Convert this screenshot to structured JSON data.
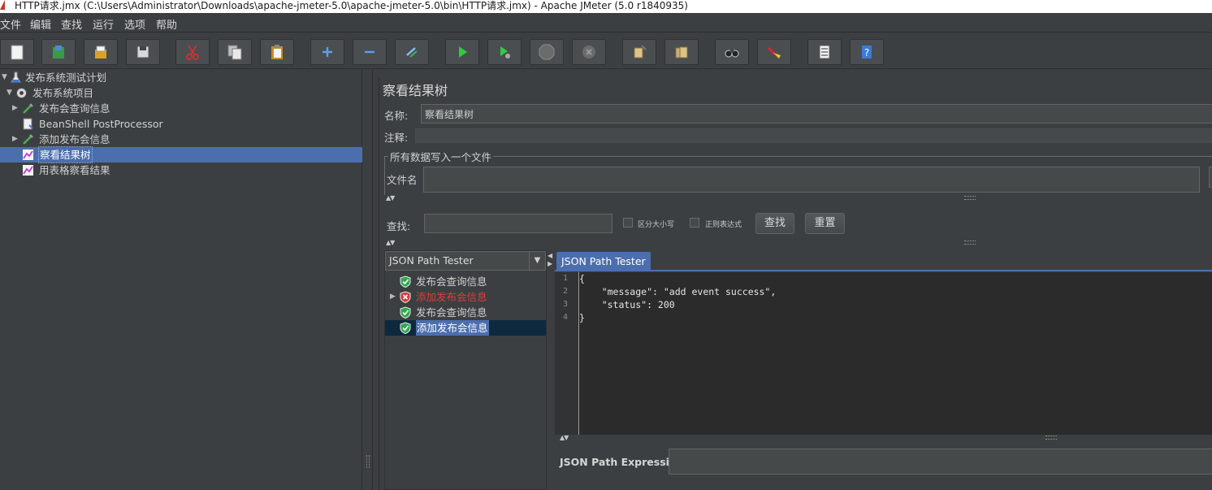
{
  "window": {
    "title": "HTTP请求.jmx (C:\\Users\\Administrator\\Downloads\\apache-jmeter-5.0\\apache-jmeter-5.0\\bin\\HTTP请求.jmx) - Apache JMeter (5.0 r1840935)"
  },
  "menu": [
    "文件",
    "编辑",
    "查找",
    "运行",
    "选项",
    "帮助"
  ],
  "toolbar": {
    "icons": [
      "new-icon",
      "templates-icon",
      "open-icon",
      "save-icon",
      "cut-icon",
      "copy-icon",
      "paste-icon",
      "expand-icon",
      "collapse-icon",
      "toggle-icon",
      "start-icon",
      "start-no-pause-icon",
      "stop-icon",
      "shutdown-icon",
      "clear-icon",
      "clear-all-icon",
      "search-icon",
      "reset-search-icon",
      "function-helper-icon",
      "help-icon"
    ]
  },
  "tree": {
    "items": [
      {
        "label": "发布系统测试计划",
        "type": "test-plan",
        "expanded": true
      },
      {
        "label": "发布系统项目",
        "type": "thread-group",
        "expanded": true
      },
      {
        "label": "发布会查询信息",
        "type": "sampler",
        "expanded": false
      },
      {
        "label": "BeanShell PostProcessor",
        "type": "post-processor"
      },
      {
        "label": "添加发布会信息",
        "type": "sampler",
        "expanded": false
      },
      {
        "label": "察看结果树",
        "type": "listener",
        "selected": true
      },
      {
        "label": "用表格察看结果",
        "type": "listener"
      }
    ]
  },
  "panel": {
    "title": "察看结果树",
    "name_label": "名称:",
    "name_value": "察看结果树",
    "comment_label": "注释:",
    "comment_value": "",
    "file_group_label": "所有数据写入一个文件",
    "filename_label": "文件名",
    "filename_value": ""
  },
  "search": {
    "label": "查找:",
    "value": "",
    "case_sensitive_label": "区分大小写",
    "case_sensitive": false,
    "regex_label": "正则表达式",
    "regex": false,
    "find_button": "查找",
    "reset_button": "重置"
  },
  "results": {
    "renderer": "JSON Path Tester",
    "items": [
      {
        "label": "发布会查询信息",
        "status": "success"
      },
      {
        "label": "添加发布会信息",
        "status": "error"
      },
      {
        "label": "发布会查询信息",
        "status": "success"
      },
      {
        "label": "添加发布会信息",
        "status": "success",
        "selected": true
      }
    ]
  },
  "tester": {
    "tab_label": "JSON Path Tester",
    "line_numbers": [
      "1",
      "2",
      "3",
      "4"
    ],
    "code_lines": [
      "{",
      "    \"message\": \"add event success\",",
      "    \"status\": 200",
      "}"
    ],
    "expression_label": "JSON Path Expression",
    "expression_value": ""
  },
  "colors": {
    "background": "#3c3f41",
    "selection": "#4b6eaf",
    "error_text": "#e23b3b",
    "success_shield": "#2fa84f"
  }
}
